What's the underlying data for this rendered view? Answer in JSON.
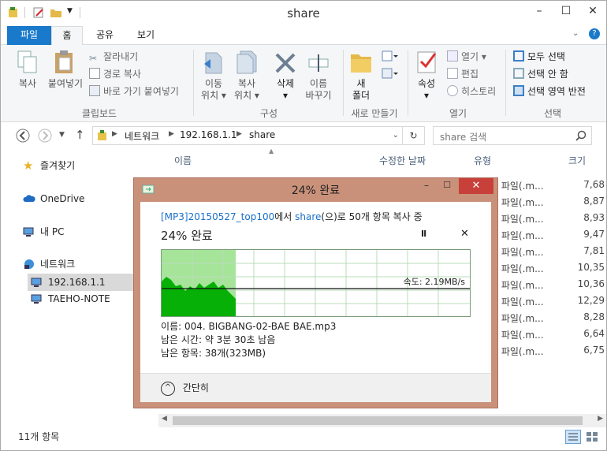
{
  "window": {
    "title": "share",
    "minimize": "–",
    "maximize": "☐",
    "close": "✕"
  },
  "ribbon": {
    "tabs": [
      {
        "label": "파일"
      },
      {
        "label": "홈"
      },
      {
        "label": "공유"
      },
      {
        "label": "보기"
      }
    ],
    "clipboard": {
      "copy": "복사",
      "paste": "붙여넣기",
      "cut": "잘라내기",
      "copy_path": "경로 복사",
      "paste_shortcut": "바로 가기 붙여넣기",
      "group": "클립보드"
    },
    "organize": {
      "move_to": [
        "이동",
        "위치 ▾"
      ],
      "copy_to": [
        "복사",
        "위치 ▾"
      ],
      "delete": [
        "삭제",
        "▾"
      ],
      "rename": [
        "이름",
        "바꾸기"
      ],
      "group": "구성"
    },
    "new": {
      "new_folder": [
        "새",
        "폴더"
      ],
      "group": "새로 만들기"
    },
    "open": {
      "properties": [
        "속성",
        "▾"
      ],
      "open": "열기 ▾",
      "edit": "편집",
      "history": "히스토리",
      "group": "열기"
    },
    "select": {
      "select_all": "모두 선택",
      "select_none": "선택 안 함",
      "invert": "선택 영역 반전",
      "group": "선택"
    }
  },
  "address": {
    "crumbs": [
      "네트워크",
      "192.168.1.1",
      "share"
    ],
    "search_placeholder": "share 검색"
  },
  "nav": {
    "favorites": "즐겨찾기",
    "onedrive": "OneDrive",
    "this_pc": "내 PC",
    "network": "네트워크",
    "host1": "192.168.1.1",
    "host2": "TAEHO-NOTE"
  },
  "columns": {
    "name": "이름",
    "modified": "수정한 날짜",
    "type": "유형",
    "size": "크기"
  },
  "files": [
    {
      "type": "오 파일(.m...",
      "size": "7,68"
    },
    {
      "type": "오 파일(.m...",
      "size": "8,87"
    },
    {
      "type": "오 파일(.m...",
      "size": "8,93"
    },
    {
      "type": "오 파일(.m...",
      "size": "9,47"
    },
    {
      "type": "오 파일(.m...",
      "size": "7,81"
    },
    {
      "type": "오 파일(.m...",
      "size": "10,35"
    },
    {
      "type": "오 파일(.m...",
      "size": "10,36"
    },
    {
      "type": "오 파일(.m...",
      "size": "12,29"
    },
    {
      "type": "오 파일(.m...",
      "size": "8,28"
    },
    {
      "type": "오 파일(.m...",
      "size": "6,64"
    },
    {
      "type": "오 파일(.m...",
      "size": "6,75"
    }
  ],
  "status": "11개 항목",
  "dialog": {
    "title": "24% 완료",
    "source_link": "[MP3]20150527_top100",
    "source_suffix": "에서 ",
    "dest_link": "share",
    "dest_suffix": "(으)로 50개 항목 복사 중",
    "progress_text": "24% 완료",
    "progress_percent": 24,
    "pause": "II",
    "cancel": "✕",
    "speed": "속도: 2.19MB/s",
    "name_line": "이름: 004. BIGBANG-02-BAE BAE.mp3",
    "time_line": "남은 시간: 약 3분 30초 남음",
    "items_line": "남은 항목: 38개(323MB)",
    "collapse": "간단히",
    "colors": {
      "fill": "#a6e49a",
      "graph": "#06b006",
      "frame": "#c9917a",
      "close": "#c7413a"
    }
  },
  "colors": {
    "accent": "#1979ca",
    "link": "#1a6fc9"
  }
}
